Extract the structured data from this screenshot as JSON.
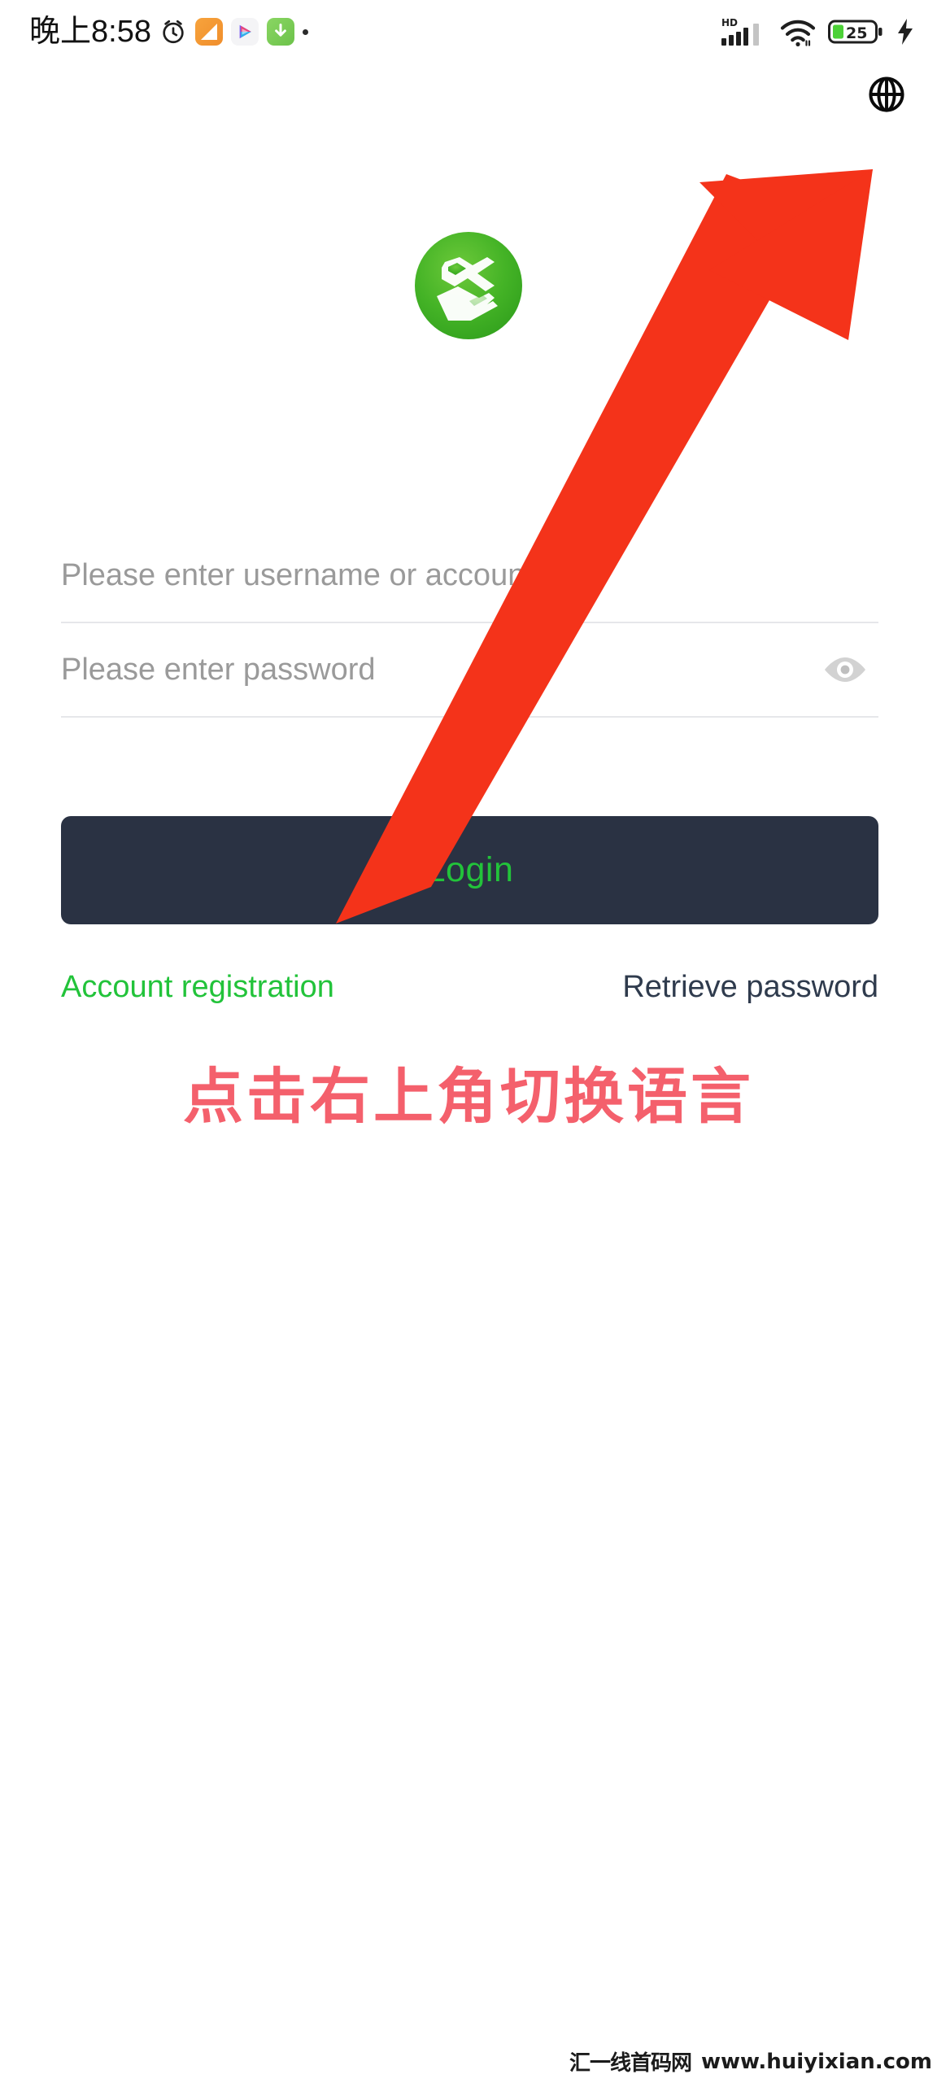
{
  "status_bar": {
    "time": "晚上8:58",
    "icons": {
      "alarm": "alarm-clock-icon",
      "note_app": "note-app-icon",
      "video_app": "video-app-icon",
      "download_app": "download-app-icon",
      "more_dot": "more-dot-icon",
      "hd": "HD",
      "signal": "cellular-signal-icon",
      "wifi": "wifi-icon",
      "battery": "battery-icon",
      "charging": "charging-bolt-icon"
    },
    "battery_percent": "25"
  },
  "header": {
    "language_button": "globe-icon"
  },
  "brand": {
    "logo": "green-hand-logo"
  },
  "form": {
    "username": {
      "placeholder": "Please enter username or account",
      "value": ""
    },
    "password": {
      "placeholder": "Please enter password",
      "value": "",
      "toggle_icon": "eye-icon"
    }
  },
  "actions": {
    "login_label": "Login",
    "register_label": "Account registration",
    "retrieve_label": "Retrieve password"
  },
  "annotation": {
    "hint_text": "点击右上角切换语言",
    "arrow": "red-arrow-pointing-top-right"
  },
  "watermark": {
    "site_name": "汇一线首码网",
    "url": "www.huiyixian.com"
  },
  "colors": {
    "brand_green": "#22c33a",
    "logo_green": "#3fae28",
    "button_dark": "#2a3243",
    "retrieve_text": "#2f3b4d",
    "hint_red": "#f4606c",
    "arrow_red": "#f4331a",
    "placeholder_gray": "#9a9a9a",
    "underline_gray": "#e6e7ea",
    "background": "#ffffff"
  }
}
